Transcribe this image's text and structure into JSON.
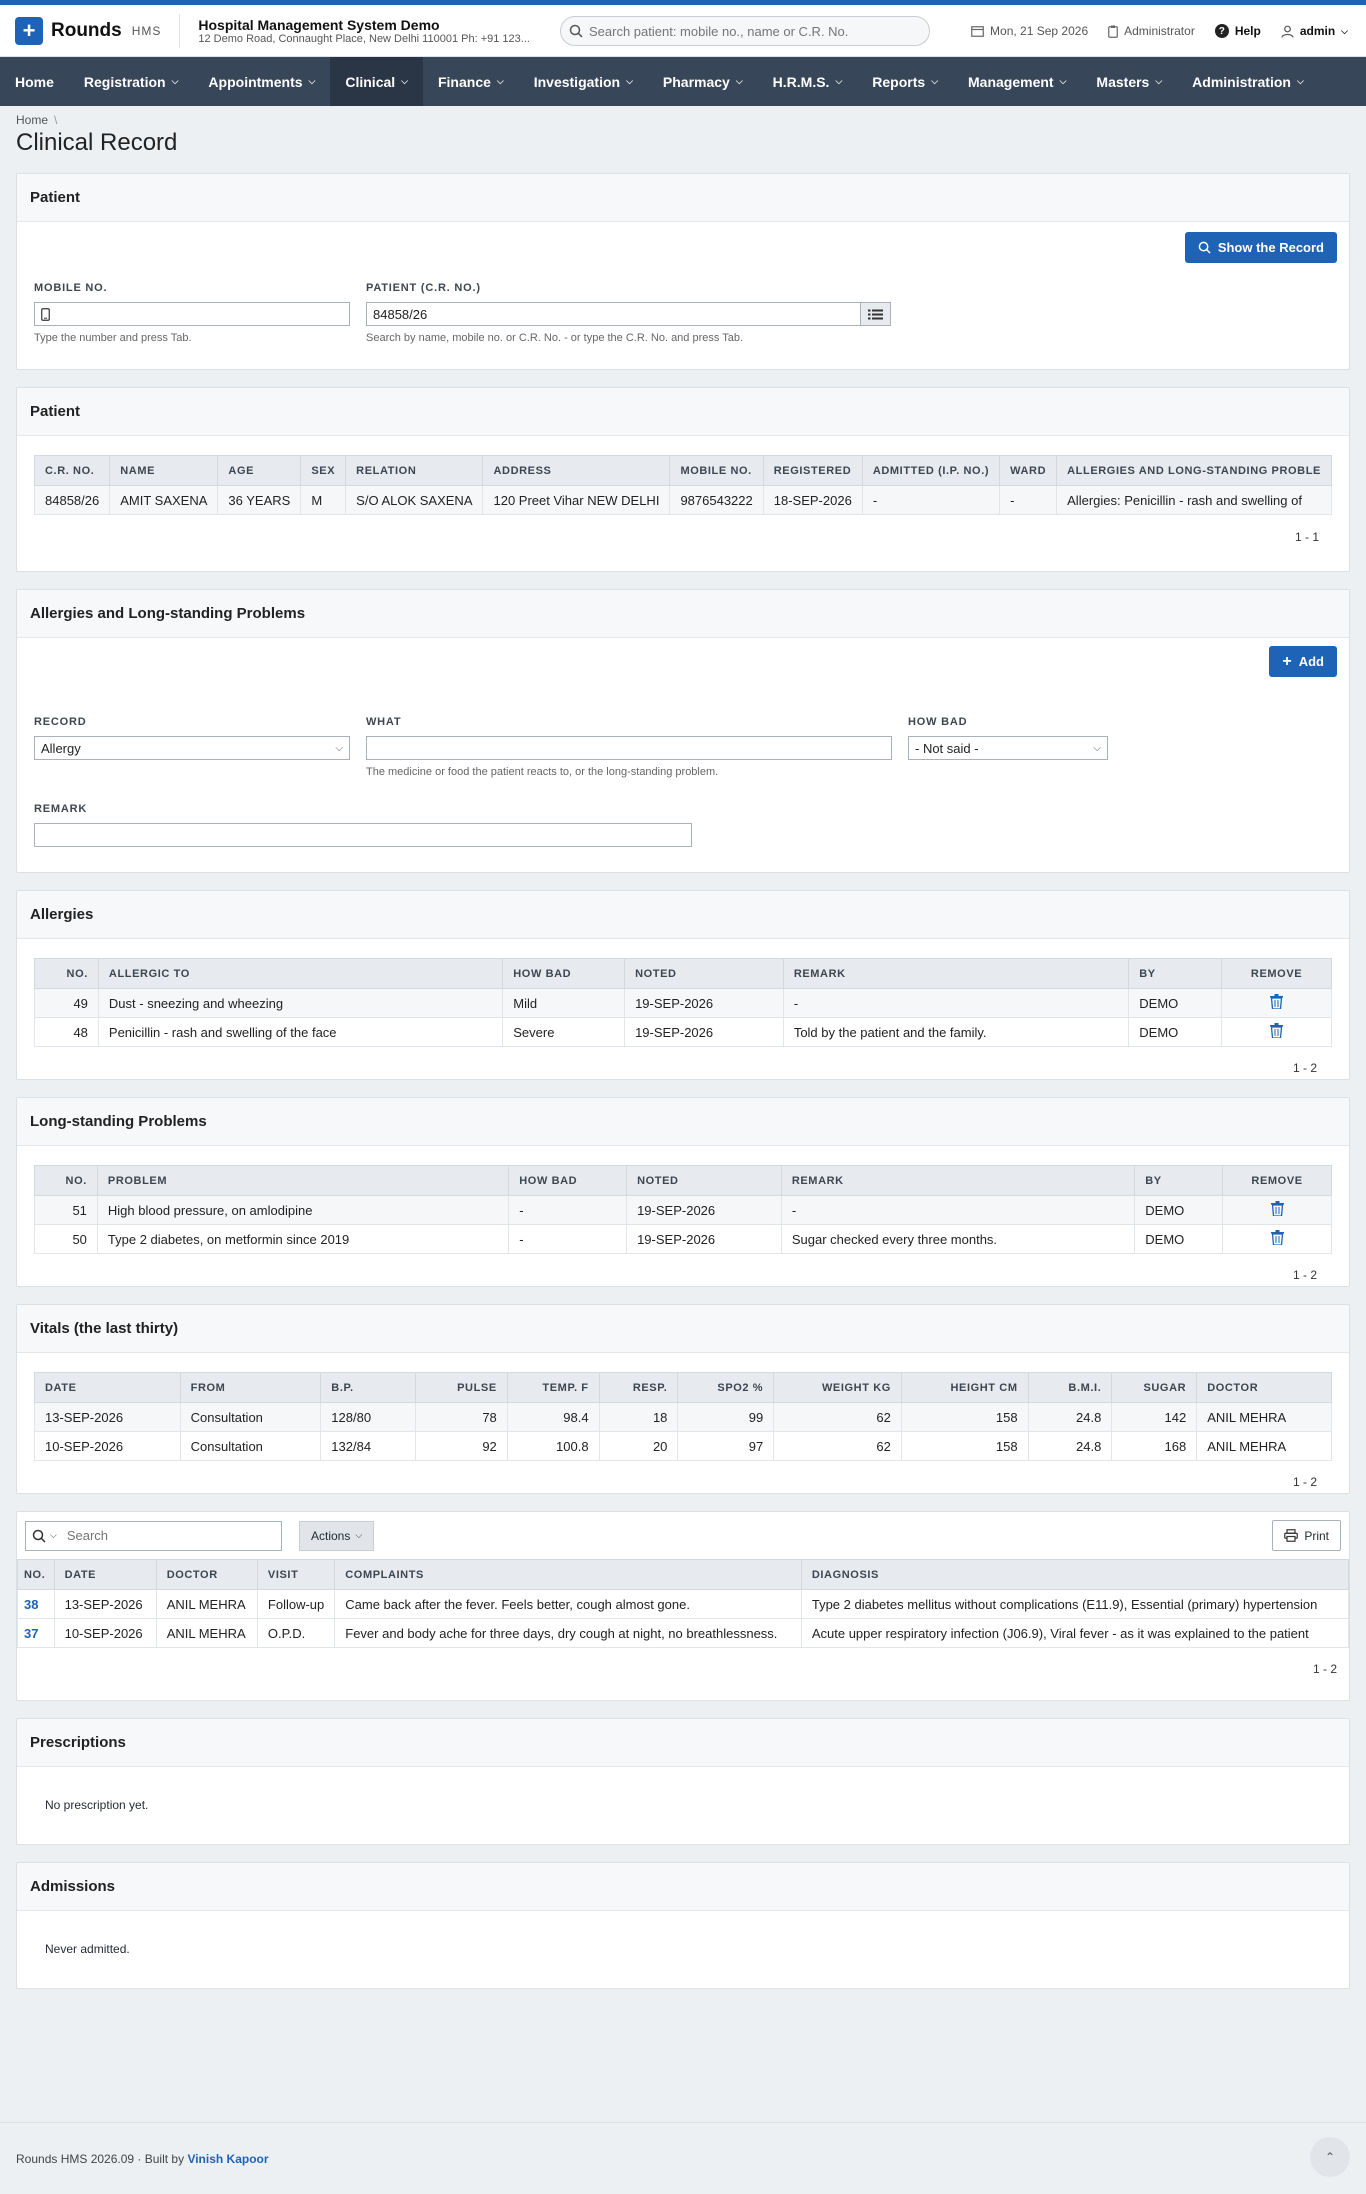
{
  "app": {
    "name": "Rounds",
    "sub": "HMS"
  },
  "hospital": {
    "name": "Hospital Management System Demo",
    "address": "12 Demo Road, Connaught Place, New Delhi 110001 Ph: +91 123..."
  },
  "header": {
    "search_placeholder": "Search patient: mobile no., name or C.R. No.",
    "date": "Mon, 21 Sep 2026",
    "role": "Administrator",
    "help": "Help",
    "user": "admin"
  },
  "nav": [
    "Home",
    "Registration",
    "Appointments",
    "Clinical",
    "Finance",
    "Investigation",
    "Pharmacy",
    "H.R.M.S.",
    "Reports",
    "Management",
    "Masters",
    "Administration"
  ],
  "breadcrumb": {
    "home": "Home",
    "sep": "\\"
  },
  "page_title": "Clinical Record",
  "patient_search": {
    "title": "Patient",
    "button": "Show the Record",
    "mobile_label": "Mobile No.",
    "mobile_help": "Type the number and press Tab.",
    "cr_label": "Patient (C.R. No.)",
    "cr_value": "84858/26",
    "cr_help": "Search by name, mobile no. or C.R. No. - or type the C.R. No. and press Tab."
  },
  "patient_info": {
    "title": "Patient",
    "columns": [
      "C.R. No.",
      "Name",
      "Age",
      "Sex",
      "Relation",
      "Address",
      "Mobile No.",
      "Registered",
      "Admitted (I.P. No.)",
      "Ward",
      "Allergies and Long-standing Proble"
    ],
    "row": [
      "84858/26",
      "AMIT SAXENA",
      "36 YEARS",
      "M",
      "S/O ALOK SAXENA",
      "120 Preet Vihar NEW DELHI",
      "9876543222",
      "18-SEP-2026",
      "-",
      "-",
      "Allergies: Penicillin - rash and swelling of"
    ],
    "pager": "1 - 1"
  },
  "allergy_form": {
    "title": "Allergies and Long-standing Problems",
    "add": "Add",
    "record_label": "Record",
    "record_value": "Allergy",
    "what_label": "What",
    "what_help": "The medicine or food the patient reacts to, or the long-standing problem.",
    "howbad_label": "How Bad",
    "howbad_value": "- Not said -",
    "remark_label": "Remark"
  },
  "allergies": {
    "title": "Allergies",
    "columns": [
      "No.",
      "Allergic To",
      "How Bad",
      "Noted",
      "Remark",
      "By",
      "Remove"
    ],
    "rows": [
      [
        "49",
        "Dust - sneezing and wheezing",
        "Mild",
        "19-SEP-2026",
        "-",
        "DEMO"
      ],
      [
        "48",
        "Penicillin - rash and swelling of the face",
        "Severe",
        "19-SEP-2026",
        "Told by the patient and the family.",
        "DEMO"
      ]
    ],
    "pager": "1 - 2"
  },
  "problems": {
    "title": "Long-standing Problems",
    "columns": [
      "No.",
      "Problem",
      "How Bad",
      "Noted",
      "Remark",
      "By",
      "Remove"
    ],
    "rows": [
      [
        "51",
        "High blood pressure, on amlodipine",
        "-",
        "19-SEP-2026",
        "-",
        "DEMO"
      ],
      [
        "50",
        "Type 2 diabetes, on metformin since 2019",
        "-",
        "19-SEP-2026",
        "Sugar checked every three months.",
        "DEMO"
      ]
    ],
    "pager": "1 - 2"
  },
  "vitals": {
    "title": "Vitals (the last thirty)",
    "columns": [
      "Date",
      "From",
      "B.P.",
      "Pulse",
      "Temp. F",
      "Resp.",
      "SpO2 %",
      "Weight Kg",
      "Height Cm",
      "B.M.I.",
      "Sugar",
      "Doctor"
    ],
    "rows": [
      [
        "13-SEP-2026",
        "Consultation",
        "128/80",
        "78",
        "98.4",
        "18",
        "99",
        "62",
        "158",
        "24.8",
        "142",
        "ANIL MEHRA"
      ],
      [
        "10-SEP-2026",
        "Consultation",
        "132/84",
        "92",
        "100.8",
        "20",
        "97",
        "62",
        "158",
        "24.8",
        "168",
        "ANIL MEHRA"
      ]
    ],
    "pager": "1 - 2"
  },
  "visits": {
    "search_placeholder": "Search",
    "actions": "Actions",
    "print": "Print",
    "columns": [
      "No.",
      "Date",
      "Doctor",
      "Visit",
      "Complaints",
      "Diagnosis"
    ],
    "rows": [
      [
        "38",
        "13-SEP-2026",
        "ANIL MEHRA",
        "Follow-up",
        "Came back after the fever. Feels better, cough almost gone.",
        "Type 2 diabetes mellitus without complications (E11.9), Essential (primary) hypertension"
      ],
      [
        "37",
        "10-SEP-2026",
        "ANIL MEHRA",
        "O.P.D.",
        "Fever and body ache for three days, dry cough at night, no breathlessness.",
        "Acute upper respiratory infection (J06.9), Viral fever - as it was explained to the patient"
      ]
    ],
    "pager": "1 - 2"
  },
  "prescriptions": {
    "title": "Prescriptions",
    "empty": "No prescription yet."
  },
  "admissions": {
    "title": "Admissions",
    "empty": "Never admitted."
  },
  "footer": {
    "text": "Rounds HMS 2026.09 · Built by",
    "author": "Vinish Kapoor"
  }
}
